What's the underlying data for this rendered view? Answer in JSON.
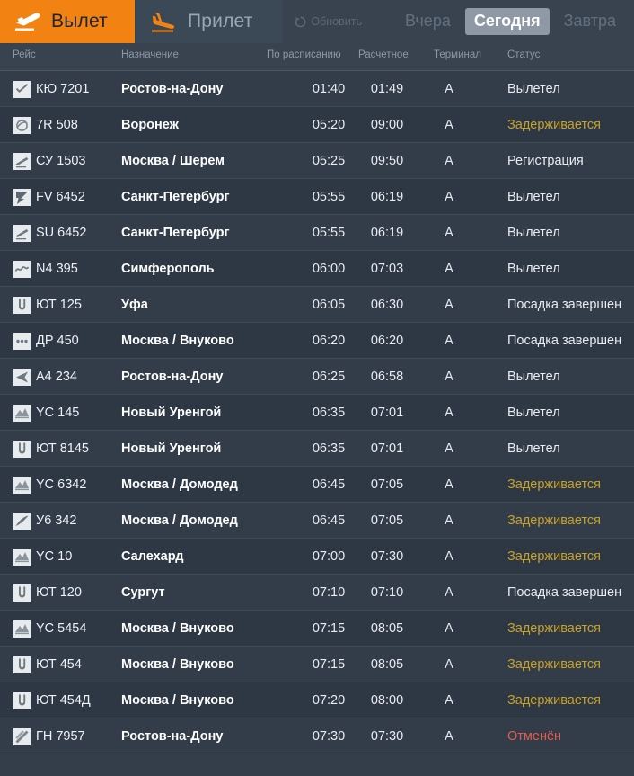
{
  "header": {
    "tabs": [
      {
        "id": "departures",
        "label": "Вылет",
        "icon": "plane-takeoff-icon",
        "active": true
      },
      {
        "id": "arrivals",
        "label": "Прилет",
        "icon": "plane-landing-icon",
        "active": false
      }
    ],
    "refresh_label": "Обновить",
    "refresh_icon": "refresh-circle-icon",
    "days": [
      {
        "id": "yesterday",
        "label": "Вчера",
        "active": false
      },
      {
        "id": "today",
        "label": "Сегодня",
        "active": true
      },
      {
        "id": "tomorrow",
        "label": "Завтра",
        "active": false
      }
    ]
  },
  "columns": {
    "flight": "Рейс",
    "destination": "Назначение",
    "scheduled": "По расписанию",
    "estimated": "Расчетное",
    "terminal": "Терминал",
    "status": "Статус"
  },
  "colors": {
    "accent": "#f28211",
    "panel": "#38434f",
    "row_odd": "#333d49",
    "row_even": "#2e3844",
    "status_normal": "#e9edf1",
    "status_delayed": "#c9a227",
    "status_cancelled": "#e05d4e",
    "day_active_bg": "#8e99a5"
  },
  "rows": [
    {
      "logo": "airline-logo-kyu",
      "flight": "КЮ 7201",
      "destination": "Ростов-на-Дону",
      "scheduled": "01:40",
      "estimated": "01:49",
      "terminal": "A",
      "status": "Вылетел",
      "status_kind": "normal"
    },
    {
      "logo": "airline-logo-7r",
      "flight": "7R 508",
      "destination": "Воронеж",
      "scheduled": "05:20",
      "estimated": "09:00",
      "terminal": "A",
      "status": "Задерживается",
      "status_kind": "delayed"
    },
    {
      "logo": "airline-logo-su",
      "flight": "СУ 1503",
      "destination": "Москва / Шерем",
      "scheduled": "05:25",
      "estimated": "09:50",
      "terminal": "A",
      "status": "Регистрация",
      "status_kind": "normal"
    },
    {
      "logo": "airline-logo-fv",
      "flight": "FV 6452",
      "destination": "Санкт-Петербург",
      "scheduled": "05:55",
      "estimated": "06:19",
      "terminal": "A",
      "status": "Вылетел",
      "status_kind": "normal"
    },
    {
      "logo": "airline-logo-su",
      "flight": "SU 6452",
      "destination": "Санкт-Петербург",
      "scheduled": "05:55",
      "estimated": "06:19",
      "terminal": "A",
      "status": "Вылетел",
      "status_kind": "normal"
    },
    {
      "logo": "airline-logo-n4",
      "flight": "N4 395",
      "destination": "Симферополь",
      "scheduled": "06:00",
      "estimated": "07:03",
      "terminal": "A",
      "status": "Вылетел",
      "status_kind": "normal"
    },
    {
      "logo": "airline-logo-ut",
      "flight": "ЮТ 125",
      "destination": "Уфа",
      "scheduled": "06:05",
      "estimated": "06:30",
      "terminal": "A",
      "status": "Посадка завершен",
      "status_kind": "normal"
    },
    {
      "logo": "airline-logo-dr",
      "flight": "ДР 450",
      "destination": "Москва / Внуково",
      "scheduled": "06:20",
      "estimated": "06:20",
      "terminal": "A",
      "status": "Посадка завершен",
      "status_kind": "normal"
    },
    {
      "logo": "airline-logo-a4",
      "flight": "A4 234",
      "destination": "Ростов-на-Дону",
      "scheduled": "06:25",
      "estimated": "06:58",
      "terminal": "A",
      "status": "Вылетел",
      "status_kind": "normal"
    },
    {
      "logo": "airline-logo-yc",
      "flight": "YC 145",
      "destination": "Новый Уренгой",
      "scheduled": "06:35",
      "estimated": "07:01",
      "terminal": "A",
      "status": "Вылетел",
      "status_kind": "normal"
    },
    {
      "logo": "airline-logo-ut",
      "flight": "ЮТ 8145",
      "destination": "Новый Уренгой",
      "scheduled": "06:35",
      "estimated": "07:01",
      "terminal": "A",
      "status": "Вылетел",
      "status_kind": "normal"
    },
    {
      "logo": "airline-logo-yc",
      "flight": "YC 6342",
      "destination": "Москва / Домодед",
      "scheduled": "06:45",
      "estimated": "07:05",
      "terminal": "A",
      "status": "Задерживается",
      "status_kind": "delayed"
    },
    {
      "logo": "airline-logo-u6",
      "flight": "У6 342",
      "destination": "Москва / Домодед",
      "scheduled": "06:45",
      "estimated": "07:05",
      "terminal": "A",
      "status": "Задерживается",
      "status_kind": "delayed"
    },
    {
      "logo": "airline-logo-yc",
      "flight": "YC 10",
      "destination": "Салехард",
      "scheduled": "07:00",
      "estimated": "07:30",
      "terminal": "A",
      "status": "Задерживается",
      "status_kind": "delayed"
    },
    {
      "logo": "airline-logo-ut",
      "flight": "ЮТ 120",
      "destination": "Сургут",
      "scheduled": "07:10",
      "estimated": "07:10",
      "terminal": "A",
      "status": "Посадка завершен",
      "status_kind": "normal"
    },
    {
      "logo": "airline-logo-yc",
      "flight": "YC 5454",
      "destination": "Москва / Внуково",
      "scheduled": "07:15",
      "estimated": "08:05",
      "terminal": "A",
      "status": "Задерживается",
      "status_kind": "delayed"
    },
    {
      "logo": "airline-logo-ut",
      "flight": "ЮТ 454",
      "destination": "Москва / Внуково",
      "scheduled": "07:15",
      "estimated": "08:05",
      "terminal": "A",
      "status": "Задерживается",
      "status_kind": "delayed"
    },
    {
      "logo": "airline-logo-ut",
      "flight": "ЮТ 454Д",
      "destination": "Москва / Внуково",
      "scheduled": "07:20",
      "estimated": "08:00",
      "terminal": "A",
      "status": "Задерживается",
      "status_kind": "delayed"
    },
    {
      "logo": "airline-logo-gn",
      "flight": "ГН 7957",
      "destination": "Ростов-на-Дону",
      "scheduled": "07:30",
      "estimated": "07:30",
      "terminal": "A",
      "status": "Отменён",
      "status_kind": "cancelled"
    }
  ]
}
